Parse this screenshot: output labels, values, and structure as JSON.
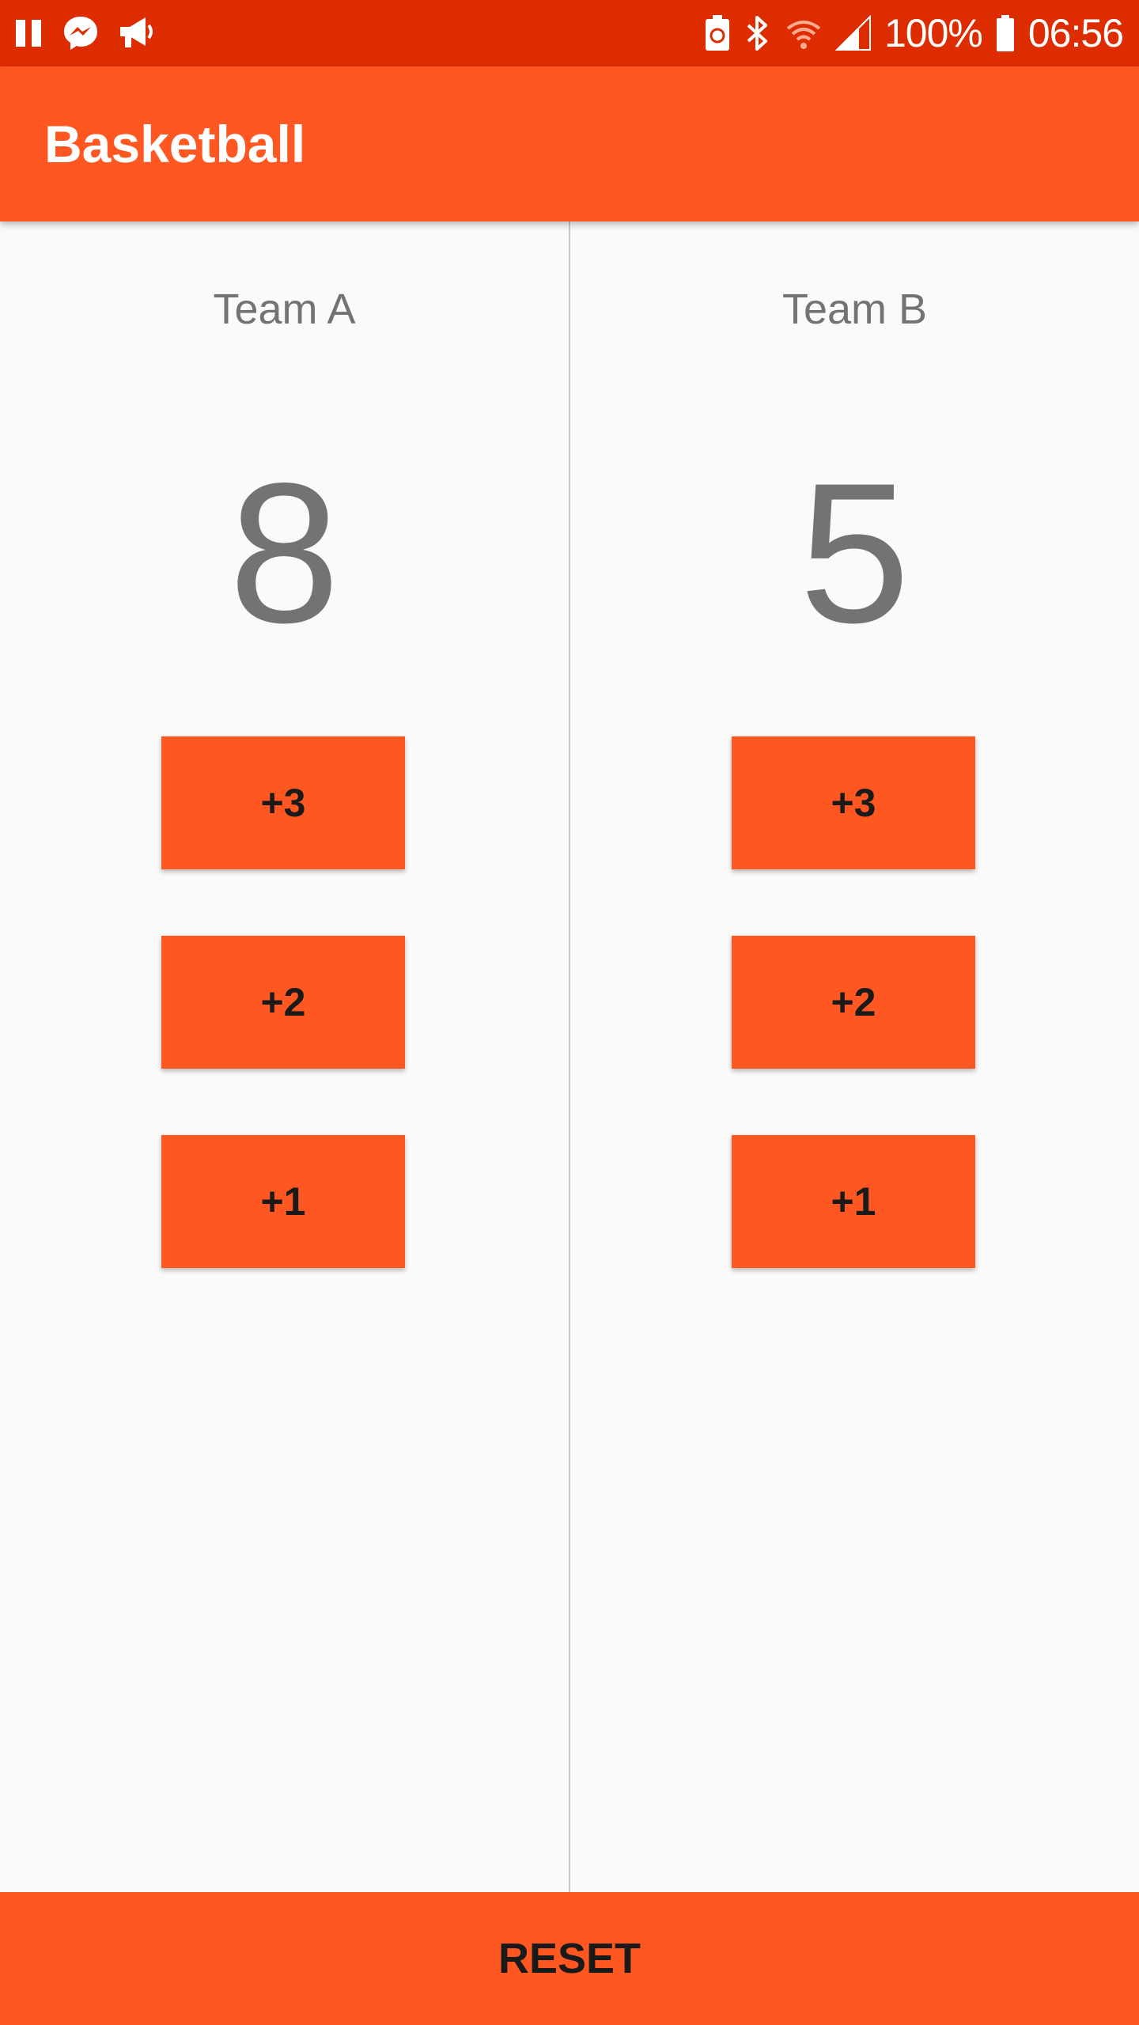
{
  "status_bar": {
    "icons_left": [
      "pause-icon",
      "messenger-icon",
      "megaphone-icon"
    ],
    "icons_right": [
      "battery-saver-icon",
      "bluetooth-icon",
      "wifi-icon",
      "signal-icon",
      "battery-icon"
    ],
    "battery_text": "100%",
    "time": "06:56"
  },
  "app_bar": {
    "title": "Basketball"
  },
  "teams": [
    {
      "name": "Team A",
      "score": "8",
      "buttons": [
        "+3",
        "+2",
        "+1"
      ]
    },
    {
      "name": "Team B",
      "score": "5",
      "buttons": [
        "+3",
        "+2",
        "+1"
      ]
    }
  ],
  "reset_label": "RESET",
  "colors": {
    "status_bar": "#dd2c00",
    "primary": "#ff5722",
    "background": "#fafafa",
    "team_text": "#737373",
    "button_text": "#1a1a1a"
  }
}
